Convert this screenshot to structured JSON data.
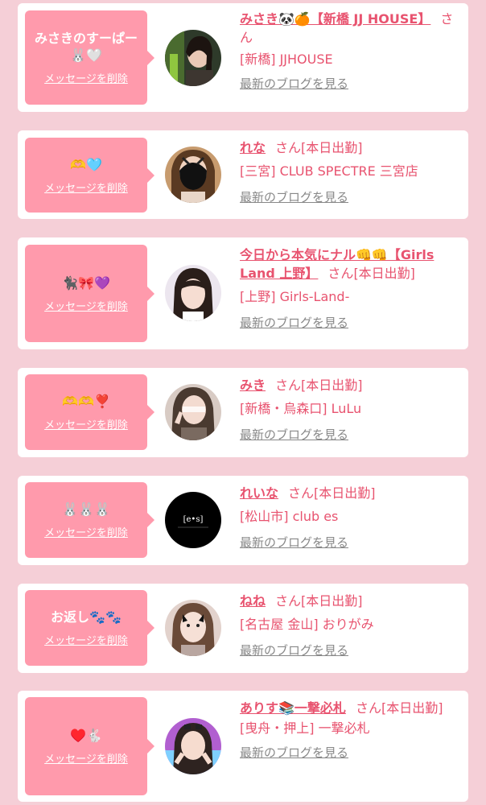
{
  "messages": [
    {
      "bubble_text": "みさきのすーぱー🐰🤍",
      "delete_label": "メッセージを削除",
      "name": "みさき🐼🍊【新橋 JJ HOUSE】",
      "san": "さん",
      "status": "",
      "shop": "[新橋] JJHOUSE",
      "blog_label": "最新のブログを見る",
      "avatar_icon": "profile-photo"
    },
    {
      "bubble_text": "🫶🩵",
      "delete_label": "メッセージを削除",
      "name": "れな",
      "san": "さん",
      "status": "[本日出勤]",
      "shop": "[三宮] CLUB SPECTRE 三宮店",
      "blog_label": "最新のブログを見る",
      "avatar_icon": "profile-photo"
    },
    {
      "bubble_text": "🐈‍⬛🎀💜",
      "delete_label": "メッセージを削除",
      "name": "今日から本気にナル👊👊【Girls Land 上野】",
      "san": "さん",
      "status": "[本日出勤]",
      "shop": "[上野] Girls-Land-",
      "blog_label": "最新のブログを見る",
      "avatar_icon": "profile-photo"
    },
    {
      "bubble_text": "🫶🫶❣️",
      "delete_label": "メッセージを削除",
      "name": "みき",
      "san": "さん",
      "status": "[本日出勤]",
      "shop": "[新橋・烏森口] LuLu",
      "blog_label": "最新のブログを見る",
      "avatar_icon": "profile-photo"
    },
    {
      "bubble_text": "🐰🐰🐰",
      "delete_label": "メッセージを削除",
      "name": "れいな",
      "san": "さん",
      "status": "[本日出勤]",
      "shop": "[松山市] club es",
      "blog_label": "最新のブログを見る",
      "avatar_icon": "club-logo",
      "avatar_logo_text": "[e•s]"
    },
    {
      "bubble_text": "お返し🐾🐾",
      "delete_label": "メッセージを削除",
      "name": "ねね",
      "san": "さん",
      "status": "[本日出勤]",
      "shop": "[名古屋 金山] おりがみ",
      "blog_label": "最新のブログを見る",
      "avatar_icon": "profile-photo"
    },
    {
      "bubble_text": "♥️🐇",
      "delete_label": "メッセージを削除",
      "name": "ありす📚一撃必札",
      "san": "さん",
      "status": "[本日出勤]",
      "shop": "[曳舟・押上] 一撃必札",
      "blog_label": "最新のブログを見る",
      "avatar_icon": "profile-photo"
    }
  ],
  "colors": {
    "page_background": "#f5cfd7",
    "bubble": "#ff9aac",
    "name_pink": "#e8536f",
    "blog_gray": "#888888"
  }
}
